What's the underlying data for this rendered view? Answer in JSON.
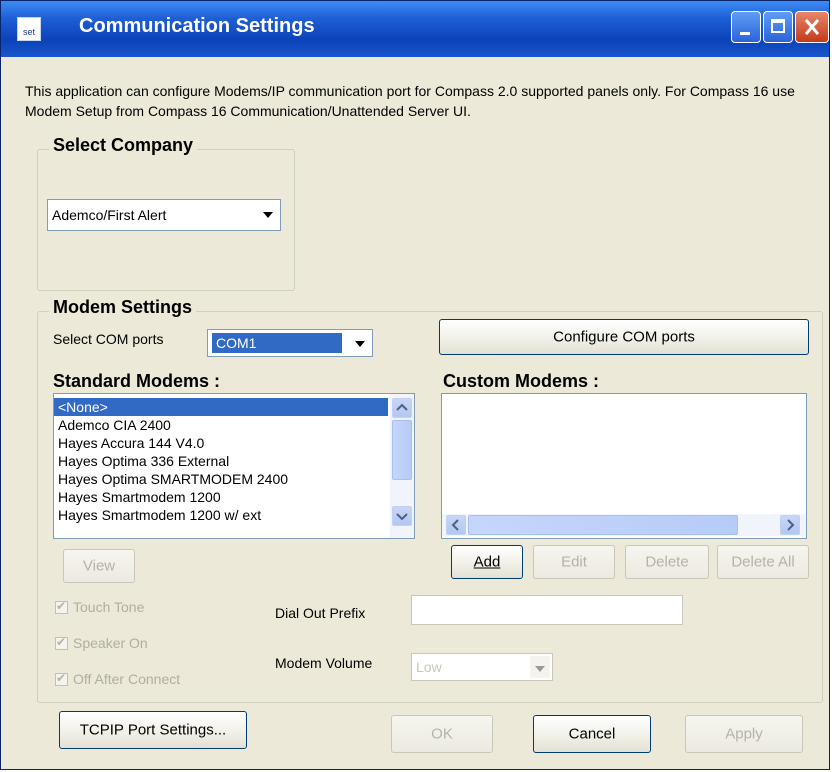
{
  "window": {
    "title": "Communication Settings",
    "icon_text": "set"
  },
  "info_text": "This application can configure Modems/IP communication port for Compass 2.0 supported panels only. For Compass 16 use Modem Setup from Compass 16 Communication/Unattended Server UI.",
  "select_company": {
    "legend": "Select Company",
    "selected": "Ademco/First Alert"
  },
  "modem_settings": {
    "legend": "Modem Settings",
    "com_label": "Select COM ports",
    "com_selected": "COM1",
    "configure_button": "Configure COM ports",
    "standard_label": "Standard Modems :",
    "custom_label": "Custom Modems :",
    "standard_modems": [
      "<None>",
      "Ademco CIA  2400",
      "Hayes Accura 144 V4.0",
      "Hayes Optima 336  External",
      "Hayes Optima SMARTMODEM 2400",
      "Hayes Smartmodem  1200",
      "Hayes Smartmodem  1200 w/ ext"
    ],
    "buttons": {
      "view": "View",
      "add": "Add",
      "edit": "Edit",
      "delete": "Delete",
      "delete_all": "Delete All"
    },
    "options": {
      "touch_tone": "Touch Tone",
      "speaker_on": "Speaker On",
      "off_after_connect": "Off After Connect"
    },
    "dial_out_prefix_label": "Dial  Out  Prefix",
    "dial_out_prefix_value": "",
    "modem_volume_label": "Modem Volume",
    "modem_volume_value": "Low"
  },
  "footer": {
    "tcpip_button": "TCPIP Port Settings...",
    "ok": "OK",
    "cancel": "Cancel",
    "apply": "Apply"
  },
  "colors": {
    "title_bar": "#0b43b8",
    "selection": "#316ac5",
    "dialog_bg": "#ece9d8"
  }
}
